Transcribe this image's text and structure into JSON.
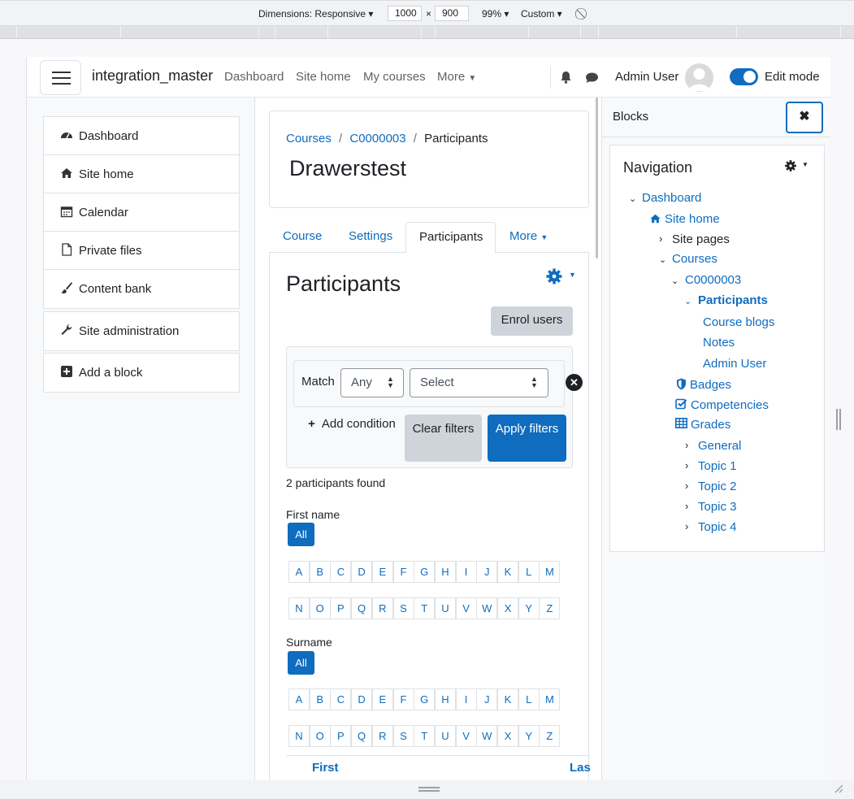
{
  "devtools": {
    "dimensions_label": "Dimensions: Responsive",
    "width": "1000",
    "times": "×",
    "height": "900",
    "zoom": "99%",
    "throttle": "Custom"
  },
  "header": {
    "site_name": "integration_master",
    "nav": [
      "Dashboard",
      "Site home",
      "My courses",
      "More"
    ],
    "user_name": "Admin User",
    "edit_mode_label": "Edit mode",
    "edit_mode_on": true
  },
  "left_drawer": {
    "items": [
      "Dashboard",
      "Site home",
      "Calendar",
      "Private files",
      "Content bank"
    ],
    "admin": "Site administration",
    "add_block": "Add a block"
  },
  "page": {
    "breadcrumb": [
      "Courses",
      "C0000003",
      "Participants"
    ],
    "breadcrumb_sep": "/",
    "title": "Drawerstest",
    "tabs": [
      "Course",
      "Settings",
      "Participants",
      "More"
    ],
    "active_tab": "Participants"
  },
  "participants": {
    "heading": "Participants",
    "enrol_button": "Enrol users",
    "match_label": "Match",
    "match_value": "Any",
    "select_value": "Select",
    "add_condition": "Add condition",
    "clear_filters": "Clear filters",
    "apply_filters": "Apply filters",
    "found_text": "2 participants found",
    "first_name_label": "First name",
    "surname_label": "Surname",
    "all_label": "All",
    "letters_row1": [
      "A",
      "B",
      "C",
      "D",
      "E",
      "F",
      "G",
      "H",
      "I",
      "J",
      "K",
      "L",
      "M"
    ],
    "letters_row2": [
      "N",
      "O",
      "P",
      "Q",
      "R",
      "S",
      "T",
      "U",
      "V",
      "W",
      "X",
      "Y",
      "Z"
    ],
    "table_headers": [
      "First",
      "Las"
    ]
  },
  "blocks": {
    "title": "Blocks",
    "nav_title": "Navigation",
    "tree": {
      "dashboard": "Dashboard",
      "site_home": "Site home",
      "site_pages": "Site pages",
      "courses": "Courses",
      "course": "C0000003",
      "participants": "Participants",
      "course_blogs": "Course blogs",
      "notes": "Notes",
      "admin_user": "Admin User",
      "badges": "Badges",
      "competencies": "Competencies",
      "grades": "Grades",
      "topics": [
        "General",
        "Topic 1",
        "Topic 2",
        "Topic 3",
        "Topic 4"
      ]
    }
  },
  "colors": {
    "primary": "#0f6cbf",
    "secondary_btn": "#ced4da",
    "text": "#1d2125"
  }
}
